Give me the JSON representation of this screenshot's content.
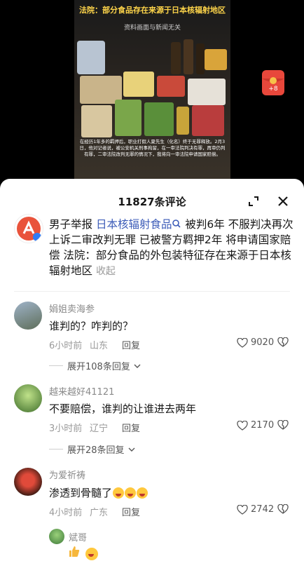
{
  "video": {
    "headline": "法院：部分食品存在来源于日本核辐射地区",
    "note": "资料画面与新闻无关",
    "caption": "在经历1年多的羁押后，职业打假人夏先生（化名）终于无罪释放。2月3日，他对记者说，被公安机关刑事拘留，在一审法院判决有罪，再审仍判有罪，二审法院改判无罪的情况下，我将向一审法院申请国家赔偿。",
    "redpacket_badge": "+8"
  },
  "sheet": {
    "title": "11827条评论",
    "expand_icon": "expand-icon",
    "close_icon": "close-icon"
  },
  "top_comment": {
    "part1": "男子举报 ",
    "link": "日本核辐射食品",
    "part2": " 被判6年 不服判决再次上诉二审改判无罪 已被警方羁押2年 将申请国家赔偿 法院：部分食品的外包装特征存在来源于日本核辐射地区 ",
    "collapse": "收起"
  },
  "comments": [
    {
      "name": "娟姐卖海参",
      "text": "谁判的？咋判的？",
      "time": "6小时前",
      "location": "山东",
      "reply": "回复",
      "likes": "9020",
      "expand": "展开108条回复"
    },
    {
      "name": "越来越好41121",
      "text": "不要赔偿，谁判的让谁进去两年",
      "time": "3小时前",
      "location": "辽宁",
      "reply": "回复",
      "likes": "2170",
      "expand": "展开28条回复"
    },
    {
      "name": "为爱祈祷",
      "text": "渗透到骨髓了",
      "time": "4小时前",
      "location": "广东",
      "reply": "回复",
      "likes": "2742",
      "expand": ""
    },
    {
      "name": "斌哥",
      "text": "",
      "time": "",
      "location": "",
      "reply": "",
      "likes": "",
      "expand": ""
    }
  ]
}
